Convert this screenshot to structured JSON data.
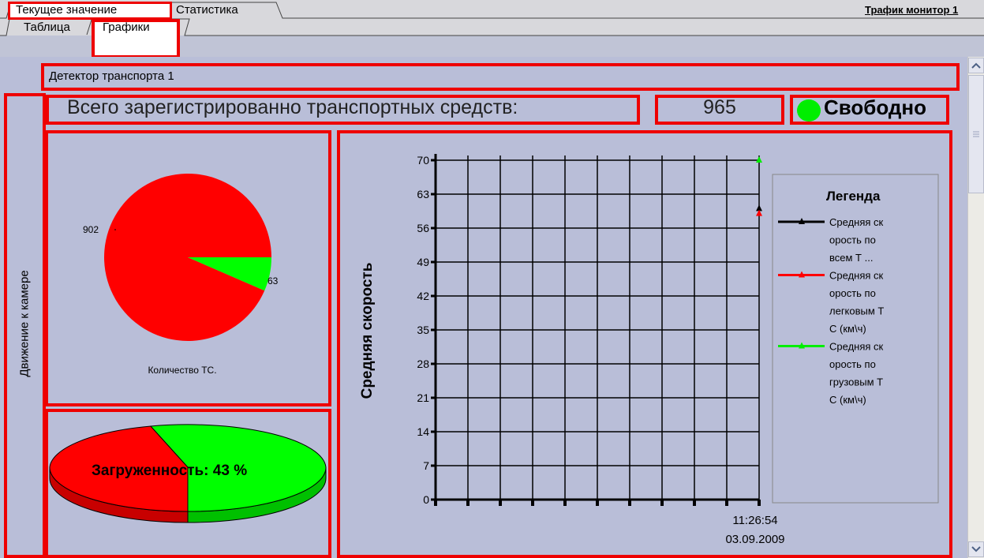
{
  "tabs_top": [
    {
      "label": "Текущее значение",
      "selected": true
    },
    {
      "label": "Статистика",
      "selected": false
    }
  ],
  "tabs_sub": [
    {
      "label": "Таблица",
      "selected": false
    },
    {
      "label": "Графики",
      "selected": true
    }
  ],
  "top_right_link": "Трафик монитор 1",
  "detector_title": "Детектор транспорта 1",
  "side_label": "Движение к камере",
  "total_label": "Всего зарегистрированно транспортных средств:",
  "total_value": "965",
  "status": {
    "label": "Свободно",
    "color": "#00ee00"
  },
  "colors": {
    "red": "#ff0000",
    "green": "#00ff00",
    "border": "#ee0000",
    "panel": "#b9bed8"
  },
  "chart_data": [
    {
      "type": "pie",
      "title": "Количество ТС.",
      "slices": [
        {
          "label": "902",
          "value": 902,
          "color": "#ff0000"
        },
        {
          "label": "63",
          "value": 63,
          "color": "#00ff00"
        }
      ]
    },
    {
      "type": "pie",
      "title": "Загруженность: 43 %",
      "slices": [
        {
          "value": 57,
          "color": "#ff0000"
        },
        {
          "value": 43,
          "color": "#00ff00"
        }
      ]
    },
    {
      "type": "line",
      "ylabel": "Средняя скорость",
      "ylim": [
        0,
        70
      ],
      "yticks": [
        "0",
        "7",
        "14",
        "21",
        "28",
        "35",
        "42",
        "49",
        "56",
        "63",
        "70"
      ],
      "x_tick_label": [
        "11:26:54",
        "03.09.2009"
      ],
      "legend_title": "Легенда",
      "grid": true,
      "series": [
        {
          "name": "Средняя скорость по всем Т ...",
          "lines": [
            "Средняя ск",
            "орость по",
            "всем Т ..."
          ],
          "color": "#000000",
          "y": 60
        },
        {
          "name": "Средняя скорость по легковым ТС (км\\ч)",
          "lines": [
            "Средняя ск",
            "орость по",
            "легковым Т",
            "С (км\\ч)"
          ],
          "color": "#ff0000",
          "y": 59
        },
        {
          "name": "Средняя скорость по грузовым ТС (км\\ч)",
          "lines": [
            "Средняя ск",
            "орость по",
            "грузовым Т",
            "С (км\\ч)"
          ],
          "color": "#00ee00",
          "y": 70
        }
      ]
    }
  ]
}
